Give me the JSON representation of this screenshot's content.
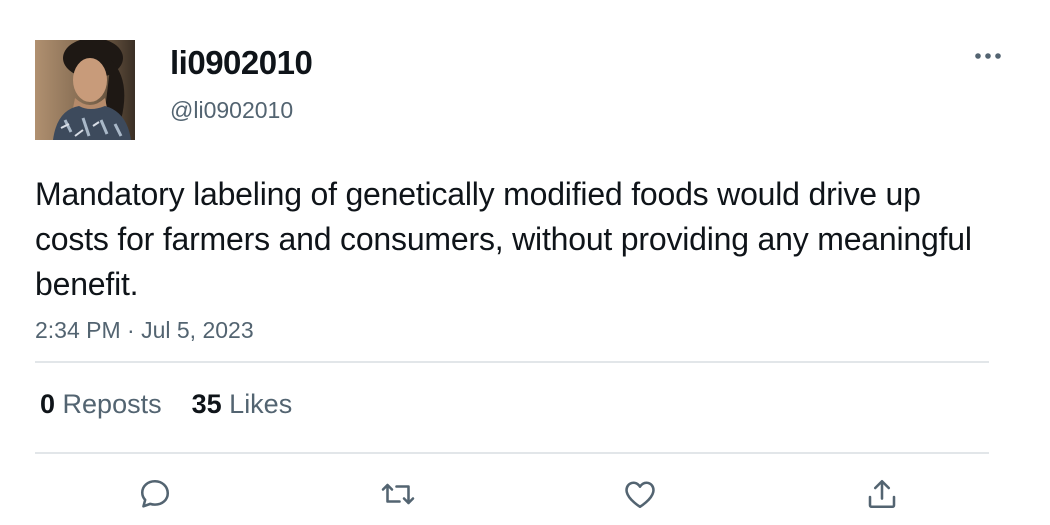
{
  "tweet": {
    "display_name": "li0902010",
    "handle": "@li0902010",
    "text": "Mandatory labeling of genetically modified foods would drive up costs for farmers and consumers, without providing any meaningful benefit.",
    "timestamp": "2:34 PM · Jul 5, 2023"
  },
  "stats": {
    "reposts_count": "0",
    "reposts_label": "Reposts",
    "likes_count": "35",
    "likes_label": "Likes"
  },
  "icons": {
    "more": "more-horizontal-icon",
    "reply": "reply-icon",
    "repost": "repost-icon",
    "like": "heart-icon",
    "share": "share-icon"
  },
  "colors": {
    "text_primary": "#0f1419",
    "text_secondary": "#536471",
    "divider": "#e2e6e9"
  }
}
